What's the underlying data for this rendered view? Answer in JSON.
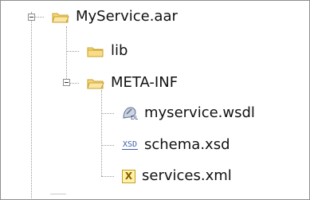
{
  "tree": {
    "nodes": [
      {
        "label": "MyService.aar",
        "icon": "folder-open-icon",
        "expanded": true
      },
      {
        "label": "lib",
        "icon": "folder-icon"
      },
      {
        "label": "META-INF",
        "icon": "folder-open-icon",
        "expanded": true
      },
      {
        "label": "myservice.wsdl",
        "icon": "wsdl-file-icon"
      },
      {
        "label": "schema.xsd",
        "icon": "xsd-file-icon"
      },
      {
        "label": "services.xml",
        "icon": "xml-file-icon"
      }
    ],
    "xsd_icon_text": "XSD",
    "xml_icon_text": "X"
  },
  "colors": {
    "folder_fill": "#f6d776",
    "folder_stroke": "#c89f2d"
  }
}
